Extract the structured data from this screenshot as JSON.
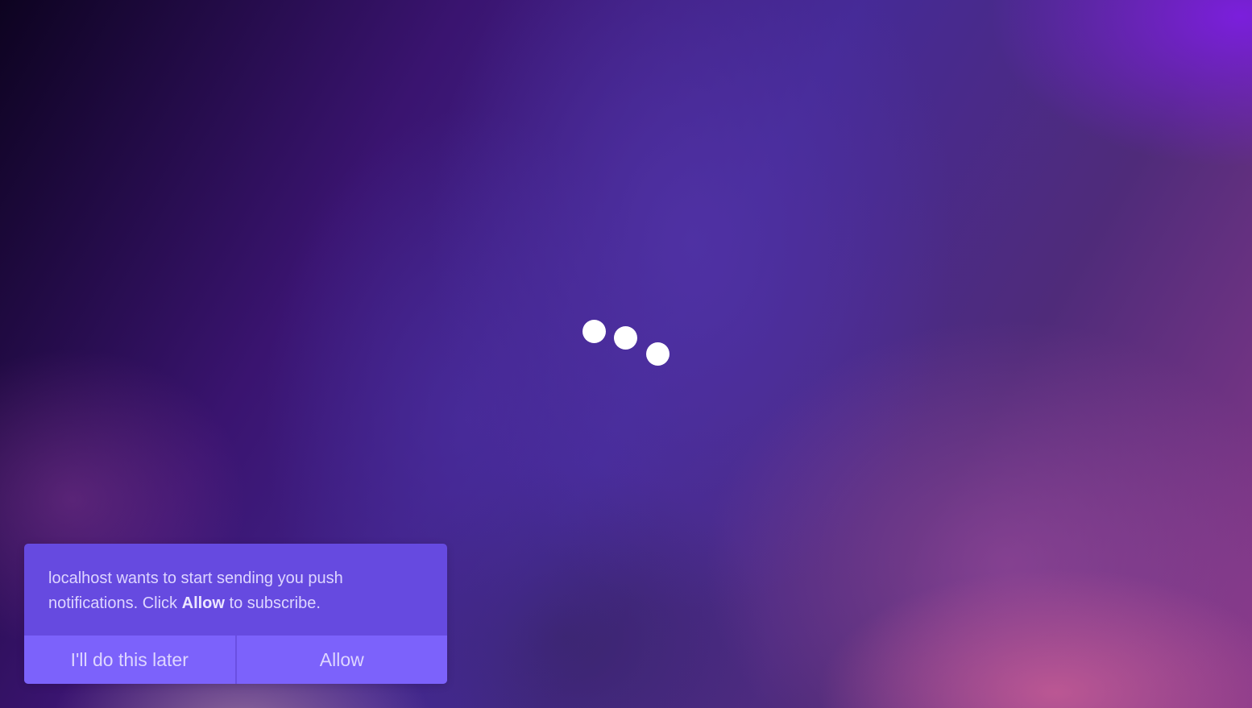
{
  "loader": {
    "dots": [
      "dot",
      "dot",
      "dot"
    ]
  },
  "notification_prompt": {
    "message_before": "localhost wants to start sending you push notifications. Click ",
    "message_emphasis": "Allow",
    "message_after": " to subscribe.",
    "later_label": "I'll do this later",
    "allow_label": "Allow"
  },
  "colors": {
    "prompt_background": "#664ae0",
    "button_background": "#7c62fb",
    "text": "#ded6ff",
    "dots": "#ffffff"
  }
}
